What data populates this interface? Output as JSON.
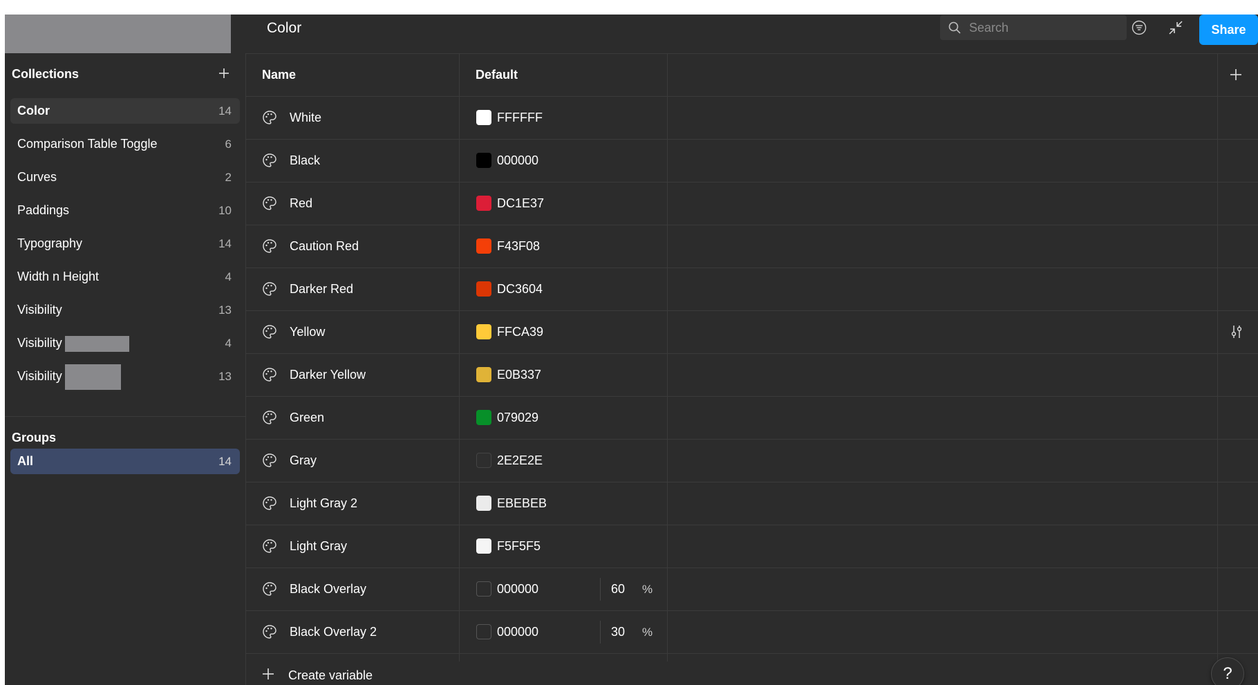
{
  "header": {
    "title": "Color",
    "search_placeholder": "Search",
    "share_label": "Share"
  },
  "sidebar": {
    "collections_heading": "Collections",
    "collections": [
      {
        "label": "Color",
        "count": "14",
        "active": true
      },
      {
        "label": "Comparison Table Toggle",
        "count": "6"
      },
      {
        "label": "Curves",
        "count": "2"
      },
      {
        "label": "Paddings",
        "count": "10"
      },
      {
        "label": "Typography",
        "count": "14"
      },
      {
        "label": "Width n Height",
        "count": "4"
      },
      {
        "label": "Visibility",
        "count": "13"
      },
      {
        "label": "Visibility",
        "count": "4",
        "redacted": true
      },
      {
        "label": "Visibility",
        "count": "13",
        "redacted": true
      }
    ],
    "groups_heading": "Groups",
    "groups": [
      {
        "label": "All",
        "count": "14",
        "active": true
      }
    ]
  },
  "table": {
    "columns": [
      "Name",
      "Default"
    ],
    "rows": [
      {
        "name": "White",
        "hex": "FFFFFF",
        "color": "#FFFFFF"
      },
      {
        "name": "Black",
        "hex": "000000",
        "color": "#000000"
      },
      {
        "name": "Red",
        "hex": "DC1E37",
        "color": "#DC1E37"
      },
      {
        "name": "Caution Red",
        "hex": "F43F08",
        "color": "#F43F08"
      },
      {
        "name": "Darker Red",
        "hex": "DC3604",
        "color": "#DC3604"
      },
      {
        "name": "Yellow",
        "hex": "FFCA39",
        "color": "#FFCA39"
      },
      {
        "name": "Darker Yellow",
        "hex": "E0B337",
        "color": "#E0B337"
      },
      {
        "name": "Green",
        "hex": "079029",
        "color": "#079029"
      },
      {
        "name": "Gray",
        "hex": "2E2E2E",
        "color": "#2E2E2E"
      },
      {
        "name": "Light Gray 2",
        "hex": "EBEBEB",
        "color": "#EBEBEB"
      },
      {
        "name": "Light Gray",
        "hex": "F5F5F5",
        "color": "#F5F5F5"
      },
      {
        "name": "Black Overlay",
        "hex": "000000",
        "color": "#000000",
        "alpha": "60",
        "alpha_unit": "%"
      },
      {
        "name": "Black Overlay 2",
        "hex": "000000",
        "color": "#000000",
        "alpha": "30",
        "alpha_unit": "%"
      }
    ],
    "create_label": "Create variable"
  },
  "help_label": "?",
  "colors": {
    "accent": "#0d99ff",
    "background": "#2c2c2c",
    "group_active": "#3d4a69"
  }
}
